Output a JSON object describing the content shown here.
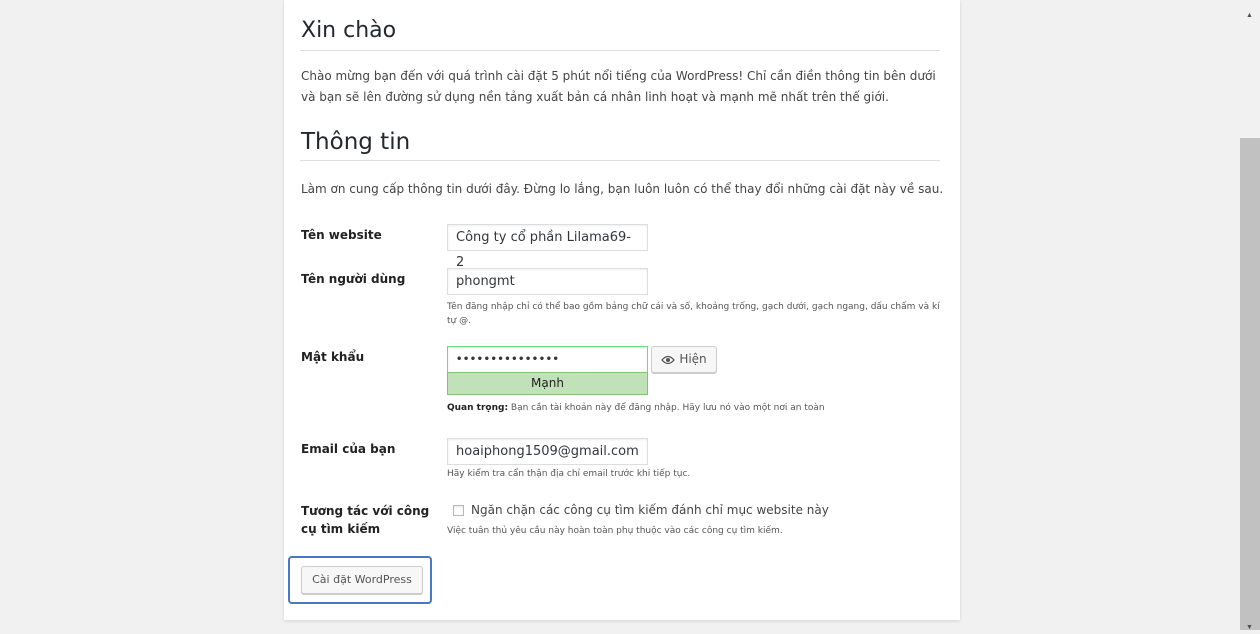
{
  "welcome": {
    "title": "Xin chào",
    "text": "Chào mừng bạn đến với quá trình cài đặt 5 phút nổi tiếng của WordPress! Chỉ cần điền thông tin bên dưới và bạn sẽ lên đường sử dụng nền tảng xuất bản cá nhân linh hoạt và mạnh mẽ nhất trên thế giới."
  },
  "info": {
    "title": "Thông tin",
    "intro": "Làm ơn cung cấp thông tin dưới đây. Đừng lo lắng, bạn luôn luôn có thể thay đổi những cài đặt này về sau."
  },
  "form": {
    "site_title": {
      "label": "Tên website",
      "value": "Công ty cổ phần Lilama69-2"
    },
    "username": {
      "label": "Tên người dùng",
      "value": "phongmt",
      "hint": "Tên đăng nhập chỉ có thể bao gồm bảng chữ cái và số, khoảng trống, gạch dưới, gạch ngang, dấu chấm và kí tự @."
    },
    "password": {
      "label": "Mật khẩu",
      "masked_value": "•••••••••••••••",
      "show_label": "Hiện",
      "strength": "Mạnh",
      "note_bold": "Quan trọng:",
      "note_text": " Bạn cần tài khoản này để đăng nhập. Hãy lưu nó vào một nơi an toàn"
    },
    "email": {
      "label": "Email của bạn",
      "value": "hoaiphong1509@gmail.com",
      "hint": "Hãy kiểm tra cẩn thận địa chỉ email trước khi tiếp tục."
    },
    "search": {
      "label_line1": "Tương tác với công",
      "label_line2": "cụ tìm kiếm",
      "checkbox_label": "Ngăn chặn các công cụ tìm kiếm đánh chỉ mục website này",
      "hint": "Việc tuân thủ yêu cầu này hoàn toàn phụ thuộc vào các công cụ tìm kiếm.",
      "checked": false
    },
    "submit_label": "Cài đặt WordPress"
  },
  "colors": {
    "strength_bg": "#c1e1b9",
    "highlight": "#4a78c8"
  }
}
